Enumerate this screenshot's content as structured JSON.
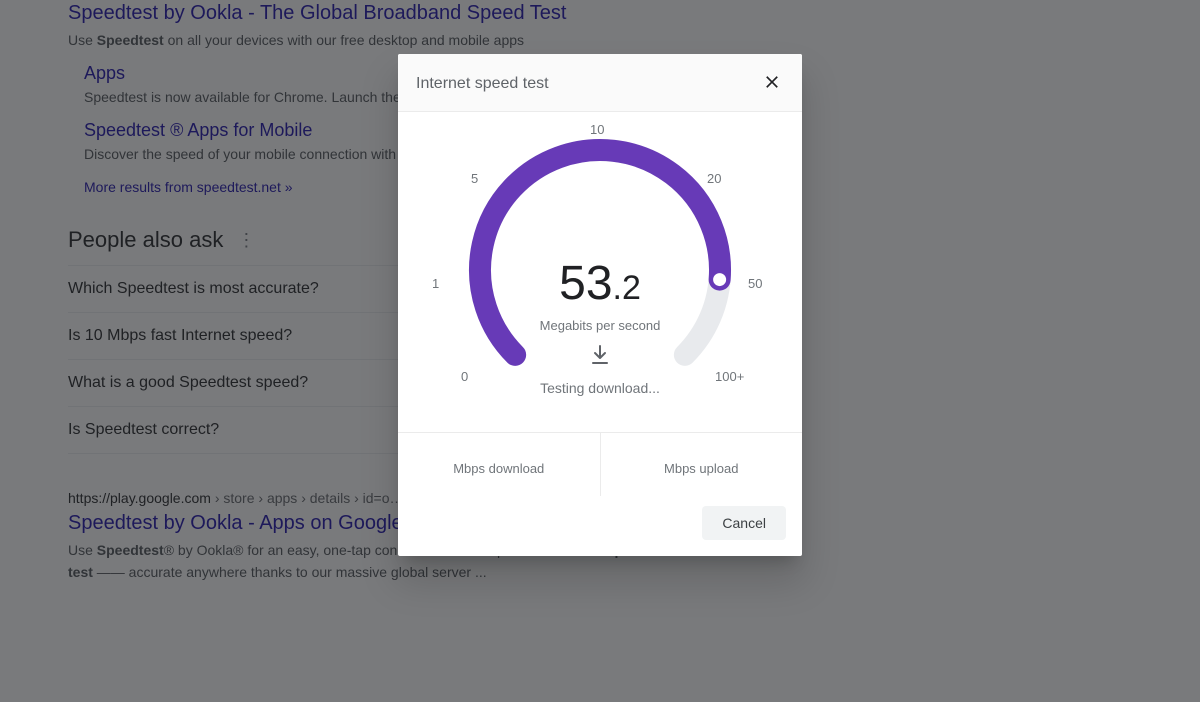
{
  "results": {
    "ookla": {
      "title": "Speedtest by Ookla - The Global Broadband Speed Test",
      "snippet_pre": "Use ",
      "snippet_bold": "Speedtest",
      "snippet_post": " on all your devices with our free desktop and mobile apps",
      "sitelinks": [
        {
          "title": "Apps",
          "snippet": "Speedtest is now available for Chrome. Launch the app from ..."
        },
        {
          "title": "Speedtest ® Apps for Mobile",
          "snippet": "Discover the speed of your mobile connection with easy, one-tap ..."
        }
      ],
      "more_results": "More results from speedtest.net »"
    },
    "paa": {
      "heading": "People also ask",
      "items": [
        "Which Speedtest is most accurate?",
        "Is 10 Mbps fast Internet speed?",
        "What is a good Speedtest speed?",
        "Is Speedtest correct?"
      ]
    },
    "playstore": {
      "breadcrumb_host": "https://play.google.com",
      "breadcrumb_path": " › store › apps › details › id=o…",
      "title": "Speedtest by Ookla - Apps on Google",
      "snippet_pre": "Use ",
      "snippet_b1": "Speedtest",
      "snippet_mid": "® by Ookla® for an easy, one-tap connection internet performance and ",
      "snippet_b2": "speed test",
      "snippet_post": " —— accurate anywhere thanks to our massive global server ..."
    }
  },
  "dialog": {
    "title": "Internet speed test",
    "gauge": {
      "value_int": "53",
      "value_dec": ".2",
      "unit": "Megabits per second",
      "status": "Testing download...",
      "ticks": {
        "t0": "0",
        "t1": "1",
        "t5": "5",
        "t10": "10",
        "t20": "20",
        "t50": "50",
        "t100": "100+"
      }
    },
    "columns": {
      "download": "Mbps download",
      "upload": "Mbps upload"
    },
    "cancel": "Cancel"
  },
  "chart_data": {
    "type": "gauge",
    "title": "Internet speed test",
    "unit": "Mbps",
    "value": 53.2,
    "scale_ticks": [
      0,
      1,
      5,
      10,
      20,
      50,
      100
    ],
    "scale_labels": [
      "0",
      "1",
      "5",
      "10",
      "20",
      "50",
      "100+"
    ],
    "range_degrees": 270,
    "fill_fraction": 0.85,
    "accent_color": "#673ab7",
    "track_color": "#e8eaed",
    "status": "Testing download..."
  }
}
